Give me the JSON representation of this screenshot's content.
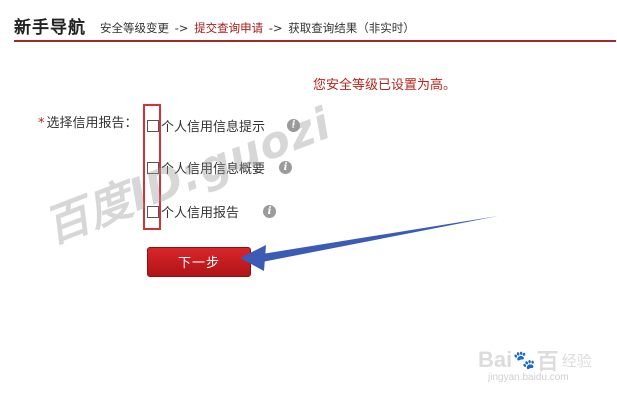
{
  "header": {
    "title": "新手导航",
    "steps": [
      {
        "label": "安全等级变更",
        "active": false
      },
      {
        "label": "提交查询申请",
        "active": true
      },
      {
        "label": "获取查询结果（非实时）",
        "active": false
      }
    ],
    "separator": "->"
  },
  "security_message": "您安全等级已设置为高。",
  "form": {
    "required_mark": "*",
    "label": "选择信用报告：",
    "options": [
      {
        "label": "个人信用信息提示",
        "checked": false,
        "info_icon": "info-icon"
      },
      {
        "label": "个人信用信息概要",
        "checked": false,
        "info_icon": "info-icon"
      },
      {
        "label": "个人信用报告",
        "checked": false,
        "info_icon": "info-icon"
      }
    ],
    "next_button": "下一步"
  },
  "watermark": "百度ID:guozi",
  "logo": {
    "brand_left": "Bai",
    "brand_right": "百",
    "product": "经验",
    "url": "jingyan.baidu.com"
  },
  "colors": {
    "accent": "#a51c1c",
    "header_rule": "#9e2b2b",
    "button": "#c91d20",
    "highlight_box": "#d0343a",
    "arrow": "#3b5bb5"
  }
}
